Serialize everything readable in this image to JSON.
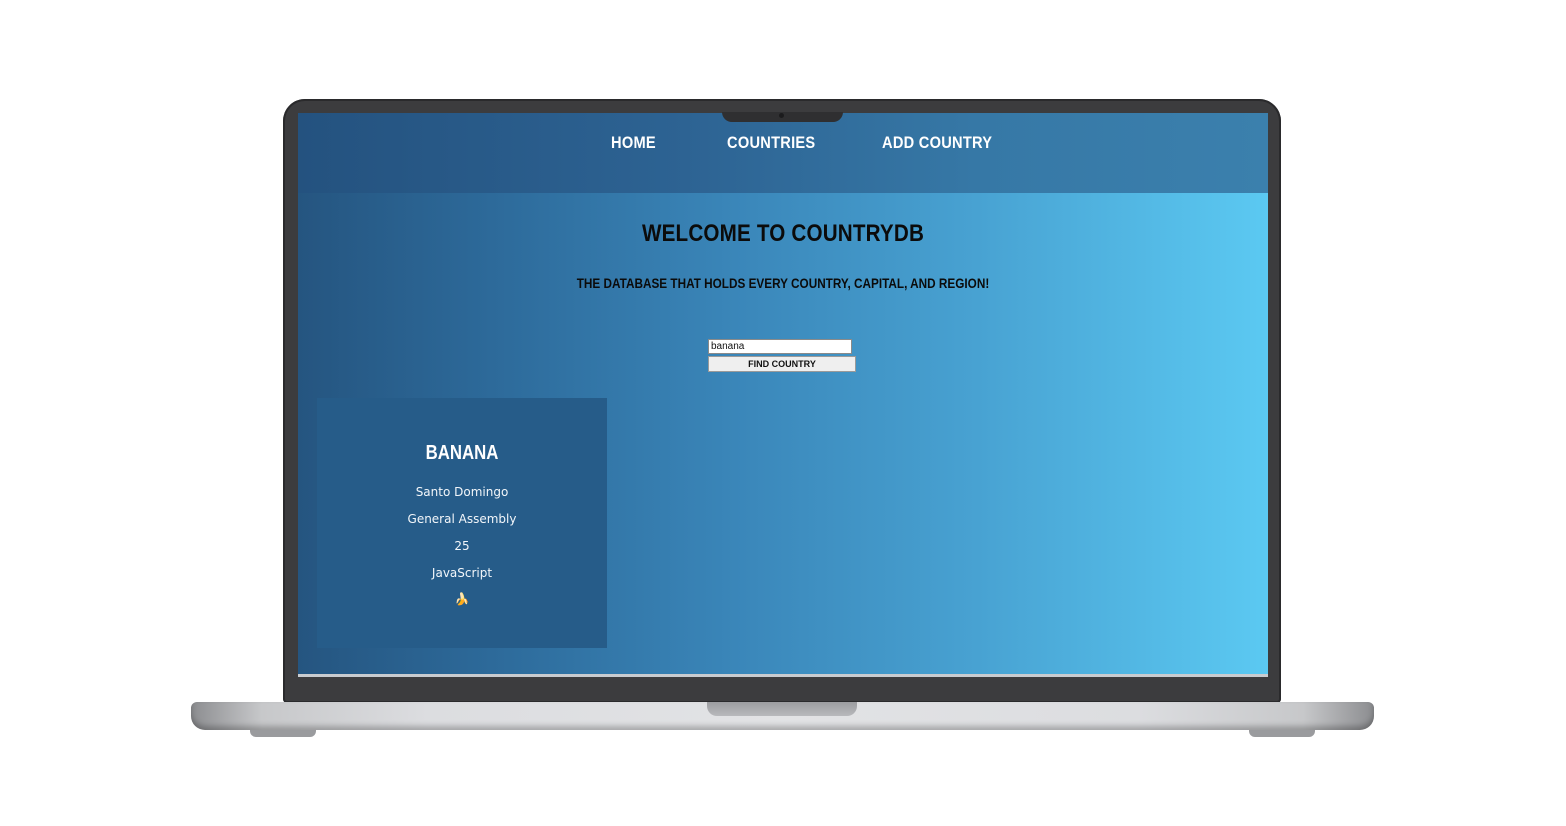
{
  "nav": {
    "items": [
      {
        "label": "Home"
      },
      {
        "label": "Countries"
      },
      {
        "label": "Add Country"
      }
    ]
  },
  "hero": {
    "title": "Welcome to CountryDB",
    "subtitle": "The database that holds every country, capital, and region!"
  },
  "search": {
    "value": "banana",
    "button_label": "Find Country"
  },
  "result_card": {
    "name": "Banana",
    "capital": "Santo Domingo",
    "region": "General Assembly",
    "population": "25",
    "language": "JavaScript",
    "flag": "🍌"
  },
  "colors": {
    "screen_gradient_start": "#255580",
    "screen_gradient_end": "#5bc9f2",
    "card_background": "#265c89",
    "bezel": "#3c3c3e"
  }
}
